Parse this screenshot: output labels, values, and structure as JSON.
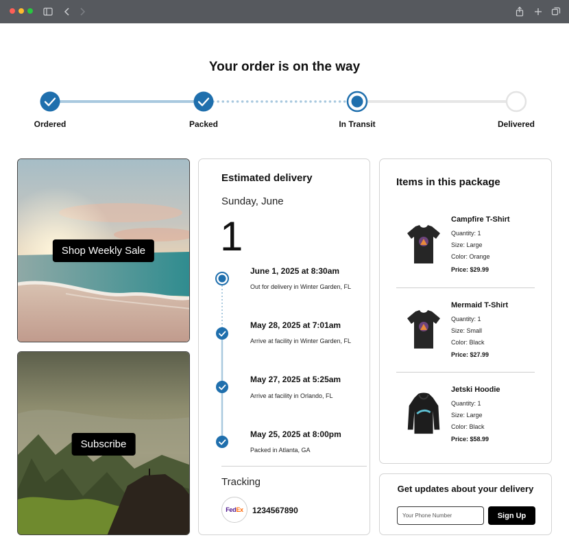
{
  "header": {
    "title": "Your order is on the way"
  },
  "steps": [
    {
      "label": "Ordered",
      "state": "done"
    },
    {
      "label": "Packed",
      "state": "done"
    },
    {
      "label": "In Transit",
      "state": "current"
    },
    {
      "label": "Delivered",
      "state": "pending"
    }
  ],
  "promos": {
    "sale_label": "Shop Weekly Sale",
    "subscribe_label": "Subscribe"
  },
  "delivery": {
    "title": "Estimated delivery",
    "date_line": "Sunday, June",
    "day": "1",
    "events": [
      {
        "title": "June 1, 2025 at 8:30am",
        "subtitle": "Out for delivery in Winter Garden, FL",
        "state": "current"
      },
      {
        "title": "May 28, 2025 at 7:01am",
        "subtitle": "Arrive at facility in Winter Garden, FL",
        "state": "done"
      },
      {
        "title": "May 27, 2025 at 5:25am",
        "subtitle": "Arrive at facility in Orlando, FL",
        "state": "done"
      },
      {
        "title": "May 25, 2025 at 8:00pm",
        "subtitle": "Packed in Atlanta, GA",
        "state": "done"
      }
    ],
    "tracking_label": "Tracking",
    "carrier": "FedEx",
    "tracking_number": "1234567890"
  },
  "package": {
    "title": "Items in this package",
    "items": [
      {
        "name": "Campfire T-Shirt",
        "quantity": "Quantity: 1",
        "size": "Size: Large",
        "color": "Color: Orange",
        "price": "Price: $29.99",
        "icon": "tshirt-icon"
      },
      {
        "name": "Mermaid T-Shirt",
        "quantity": "Quantity: 1",
        "size": "Size: Small",
        "color": "Color: Black",
        "price": "Price: $27.99",
        "icon": "tshirt-icon"
      },
      {
        "name": "Jetski Hoodie",
        "quantity": "Quantity: 1",
        "size": "Size: Large",
        "color": "Color: Black",
        "price": "Price: $58.99",
        "icon": "hoodie-icon"
      }
    ]
  },
  "updates": {
    "title": "Get updates about your delivery",
    "phone_placeholder": "Your Phone Number",
    "signup_label": "Sign Up"
  },
  "colors": {
    "accent": "#1f6fad",
    "progress_light": "#a9c9df",
    "track_grey": "#e6e6e6",
    "chrome": "#56595e"
  }
}
